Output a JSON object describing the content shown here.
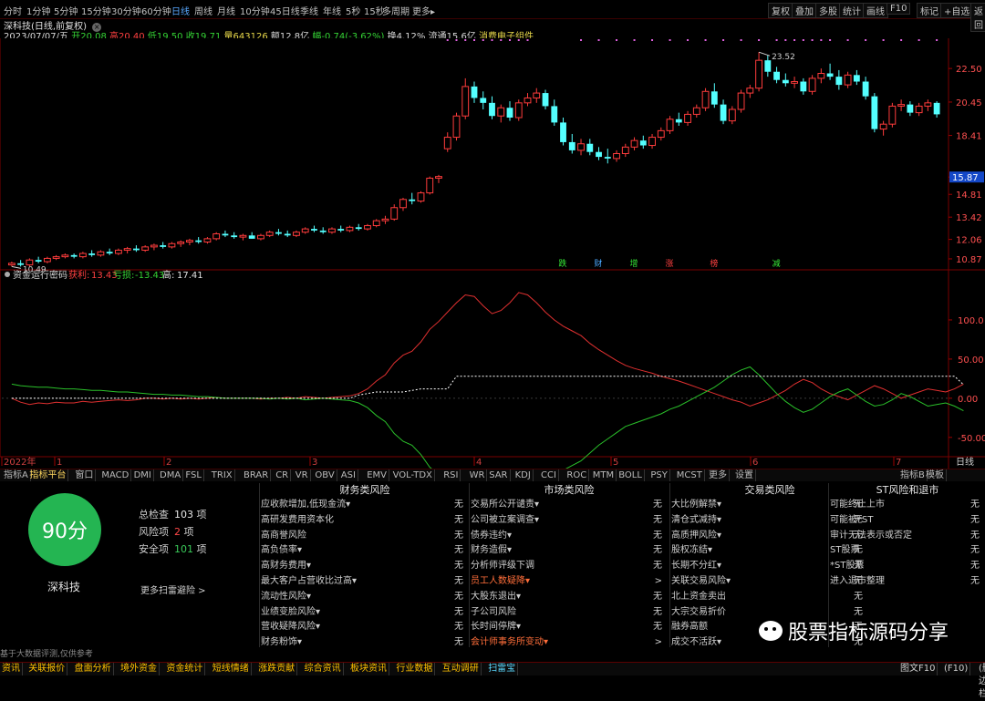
{
  "periods": [
    "分时",
    "1分钟",
    "5分钟",
    "15分钟",
    "30分钟",
    "60分钟",
    "日线",
    "周线",
    "月线",
    "10分钟",
    "45日线",
    "季线",
    "年线",
    "5秒",
    "15秒",
    "多周期",
    "更多▸"
  ],
  "active_period": "日线",
  "right_tools": [
    "复权",
    "叠加",
    "多股",
    "统计",
    "画线",
    "F10",
    "标记",
    "+自选",
    "返回"
  ],
  "title_line": "深科技(日线,前复权)",
  "info": {
    "date": "2023/07/07/五",
    "open_label": "开",
    "open": "20.08",
    "high_label": "高",
    "high": "20.40",
    "low_label": "低",
    "low": "19.50",
    "close_label": "收",
    "close": "19.71",
    "vol_label": "量",
    "vol": "643126",
    "amt_label": "额",
    "amt": "12.8亿",
    "chg_label": "幅",
    "chg": "-0.74(-3.62%)",
    "turn_label": "换",
    "turn": "4.12%",
    "float_label": "流通",
    "float": "15.6亿",
    "concept": "消费电子组件"
  },
  "price_axis": [
    "22.50",
    "20.45",
    "18.41",
    "15.87",
    "14.81",
    "13.42",
    "12.06",
    "10.87"
  ],
  "current_price_tag": "15.87",
  "price_high_mark": "23.52",
  "price_low_mark": "10.49",
  "markers": [
    "跌",
    "财",
    "增",
    "涨",
    "榜",
    "减"
  ],
  "indicator": {
    "name": "资金运行密码",
    "l1_label": "获利",
    "l1_value": "13.43",
    "l2_label": "亏损",
    "l2_value": "-13.43",
    "l3_label": "高",
    "l3_value": "17.41"
  },
  "ind_axis": [
    "100.0",
    "50.00",
    "0.00",
    "-50.00"
  ],
  "time_axis": [
    "2022年",
    "1",
    "2",
    "3",
    "4",
    "5",
    "6",
    "7"
  ],
  "time_axis_right": "日线",
  "tabs": [
    "指标A",
    "指标平台",
    "窗口",
    "MACD",
    "DMI",
    "DMA",
    "FSL",
    "TRIX",
    "BRAR",
    "CR",
    "VR",
    "OBV",
    "ASI",
    "EMV",
    "VOL-TDX",
    "RSI",
    "WR",
    "SAR",
    "KDJ",
    "CCI",
    "ROC",
    "MTM",
    "BOLL",
    "PSY",
    "MCST",
    "更多",
    "设置"
  ],
  "tabs_right": [
    "指标B",
    "模板"
  ],
  "score": {
    "value": "90分",
    "stock": "深科技",
    "total_label": "总检查",
    "total": "103",
    "total_unit": "项",
    "risk_label": "风险项",
    "risk": "2",
    "risk_unit": "项",
    "safe_label": "安全项",
    "safe": "101",
    "safe_unit": "项",
    "more": "更多扫雷避险 >",
    "disclaimer": "基于大数据评测,仅供参考"
  },
  "columns": [
    {
      "title": "财务类风险",
      "rows": [
        {
          "label": "应收款增加,低现金流▾",
          "v": "无"
        },
        {
          "label": "高研发费用资本化",
          "v": "无"
        },
        {
          "label": "高商誉风险",
          "v": "无"
        },
        {
          "label": "高负债率▾",
          "v": "无"
        },
        {
          "label": "高财务费用▾",
          "v": "无"
        },
        {
          "label": "最大客户占营收比过高▾",
          "v": "无"
        },
        {
          "label": "流动性风险▾",
          "v": "无"
        },
        {
          "label": "业绩变脸风险▾",
          "v": "无"
        },
        {
          "label": "营收疑降风险▾",
          "v": "无"
        },
        {
          "label": "财务粉饰▾",
          "v": "无"
        }
      ]
    },
    {
      "title": "市场类风险",
      "rows": [
        {
          "label": "交易所公开谴责▾",
          "v": "无"
        },
        {
          "label": "公司被立案调查▾",
          "v": "无"
        },
        {
          "label": "债券违约▾",
          "v": "无"
        },
        {
          "label": "财务造假▾",
          "v": "无"
        },
        {
          "label": "分析师评级下调",
          "v": "无"
        },
        {
          "label": "员工人数疑降▾",
          "v": ">",
          "warn": true
        },
        {
          "label": "大股东退出▾",
          "v": "无"
        },
        {
          "label": "子公司风险",
          "v": "无"
        },
        {
          "label": "长时间停牌▾",
          "v": "无"
        },
        {
          "label": "会计师事务所变动▾",
          "v": ">",
          "warn": true
        }
      ]
    },
    {
      "title": "交易类风险",
      "rows": [
        {
          "label": "大比例解禁▾",
          "v": "无"
        },
        {
          "label": "清仓式减持▾",
          "v": "无"
        },
        {
          "label": "高质押风险▾",
          "v": "无"
        },
        {
          "label": "股权冻结▾",
          "v": "无"
        },
        {
          "label": "长期不分红▾",
          "v": "无"
        },
        {
          "label": "关联交易风险▾",
          "v": "无"
        },
        {
          "label": "北上资金卖出",
          "v": "无"
        },
        {
          "label": "大宗交易折价",
          "v": "无"
        },
        {
          "label": "融券高额",
          "v": "无"
        },
        {
          "label": "成交不活跃▾",
          "v": "无"
        }
      ]
    },
    {
      "title": "ST风险和退市",
      "rows": [
        {
          "label": "可能终止上市",
          "v": "无"
        },
        {
          "label": "可能被*ST",
          "v": "无"
        },
        {
          "label": "审计无法表示或否定",
          "v": "无"
        },
        {
          "label": "ST股票",
          "v": "无"
        },
        {
          "label": "*ST股票",
          "v": "无"
        },
        {
          "label": "进入退市整理",
          "v": "无"
        }
      ]
    }
  ],
  "watermark": "股票指标源码分享",
  "footer": [
    "资讯",
    "关联报价",
    "盘面分析",
    "境外资金",
    "资金统计",
    "短线情绪",
    "涨跌贡献",
    "综合资讯",
    "板块资讯",
    "行业数据",
    "互动调研",
    "扫雷宝"
  ],
  "footer_right": [
    "图文F10",
    "(F10)",
    "(删边栏)"
  ],
  "chart_data": [
    {
      "type": "candlestick",
      "title": "深科技(日线,前复权)",
      "ylim": [
        10.2,
        23.9
      ],
      "ohlc": [
        [
          10.5,
          10.7,
          10.4,
          10.6
        ],
        [
          10.6,
          10.8,
          10.4,
          10.5
        ],
        [
          10.5,
          10.9,
          10.4,
          10.8
        ],
        [
          10.8,
          11.0,
          10.6,
          10.7
        ],
        [
          10.7,
          11.0,
          10.6,
          10.9
        ],
        [
          10.9,
          11.1,
          10.8,
          11.0
        ],
        [
          11.0,
          11.2,
          10.9,
          11.1
        ],
        [
          11.1,
          11.2,
          10.9,
          11.0
        ],
        [
          11.0,
          11.3,
          10.9,
          11.2
        ],
        [
          11.2,
          11.4,
          11.0,
          11.1
        ],
        [
          11.1,
          11.4,
          11.0,
          11.3
        ],
        [
          11.3,
          11.5,
          11.1,
          11.2
        ],
        [
          11.2,
          11.5,
          11.1,
          11.4
        ],
        [
          11.4,
          11.6,
          11.2,
          11.5
        ],
        [
          11.5,
          11.7,
          11.3,
          11.4
        ],
        [
          11.4,
          11.7,
          11.3,
          11.6
        ],
        [
          11.6,
          11.8,
          11.4,
          11.7
        ],
        [
          11.7,
          11.9,
          11.5,
          11.6
        ],
        [
          11.6,
          11.9,
          11.5,
          11.8
        ],
        [
          11.8,
          12.0,
          11.6,
          11.9
        ],
        [
          11.9,
          12.1,
          11.7,
          12.0
        ],
        [
          12.0,
          12.2,
          11.8,
          11.9
        ],
        [
          11.9,
          12.2,
          11.8,
          12.1
        ],
        [
          12.1,
          12.5,
          12.0,
          12.4
        ],
        [
          12.4,
          12.6,
          12.2,
          12.3
        ],
        [
          12.3,
          12.5,
          12.1,
          12.2
        ],
        [
          12.2,
          12.4,
          12.0,
          12.3
        ],
        [
          12.3,
          12.5,
          12.1,
          12.1
        ],
        [
          12.1,
          12.4,
          12.0,
          12.3
        ],
        [
          12.3,
          12.6,
          12.2,
          12.5
        ],
        [
          12.5,
          12.7,
          12.3,
          12.4
        ],
        [
          12.4,
          12.6,
          12.2,
          12.3
        ],
        [
          12.3,
          12.6,
          12.2,
          12.5
        ],
        [
          12.5,
          12.8,
          12.4,
          12.7
        ],
        [
          12.7,
          12.9,
          12.5,
          12.6
        ],
        [
          12.6,
          12.8,
          12.4,
          12.5
        ],
        [
          12.5,
          12.8,
          12.4,
          12.7
        ],
        [
          12.7,
          12.9,
          12.5,
          12.6
        ],
        [
          12.6,
          12.9,
          12.5,
          12.8
        ],
        [
          12.8,
          13.0,
          12.6,
          12.7
        ],
        [
          12.7,
          13.0,
          12.6,
          12.9
        ],
        [
          12.9,
          13.3,
          12.8,
          13.2
        ],
        [
          13.2,
          13.5,
          13.0,
          13.3
        ],
        [
          13.3,
          14.2,
          13.2,
          14.0
        ],
        [
          14.0,
          14.6,
          13.8,
          14.5
        ],
        [
          14.5,
          14.9,
          14.2,
          14.4
        ],
        [
          14.4,
          15.0,
          14.3,
          14.9
        ],
        [
          14.9,
          15.9,
          14.8,
          15.8
        ],
        [
          15.8,
          16.0,
          15.5,
          15.9
        ],
        [
          17.6,
          18.6,
          17.4,
          18.3
        ],
        [
          18.3,
          19.8,
          18.1,
          19.6
        ],
        [
          19.6,
          21.9,
          19.4,
          21.4
        ],
        [
          21.4,
          21.7,
          20.4,
          20.7
        ],
        [
          20.7,
          21.1,
          20.0,
          20.4
        ],
        [
          20.4,
          20.8,
          19.4,
          19.6
        ],
        [
          19.6,
          20.3,
          19.2,
          20.1
        ],
        [
          20.1,
          20.5,
          19.3,
          19.5
        ],
        [
          19.5,
          20.6,
          19.3,
          20.4
        ],
        [
          20.4,
          21.0,
          20.2,
          20.7
        ],
        [
          20.7,
          21.3,
          20.4,
          21.0
        ],
        [
          21.0,
          21.2,
          20.0,
          20.2
        ],
        [
          20.2,
          20.6,
          19.0,
          19.2
        ],
        [
          19.2,
          19.5,
          17.8,
          18.0
        ],
        [
          18.0,
          18.5,
          17.3,
          17.5
        ],
        [
          17.5,
          18.2,
          17.2,
          17.9
        ],
        [
          17.9,
          18.2,
          17.2,
          17.4
        ],
        [
          17.4,
          17.7,
          16.9,
          17.1
        ],
        [
          17.1,
          17.6,
          16.7,
          17.0
        ],
        [
          17.0,
          17.5,
          16.8,
          17.3
        ],
        [
          17.3,
          17.9,
          17.1,
          17.7
        ],
        [
          17.7,
          18.3,
          17.5,
          18.1
        ],
        [
          18.1,
          18.4,
          17.6,
          17.8
        ],
        [
          17.8,
          18.5,
          17.6,
          18.3
        ],
        [
          18.3,
          18.9,
          18.1,
          18.7
        ],
        [
          18.7,
          19.6,
          18.5,
          19.4
        ],
        [
          19.4,
          19.8,
          19.0,
          19.2
        ],
        [
          19.2,
          19.9,
          19.0,
          19.7
        ],
        [
          19.7,
          20.3,
          19.5,
          20.1
        ],
        [
          20.1,
          21.3,
          19.9,
          21.1
        ],
        [
          21.1,
          21.6,
          20.1,
          20.3
        ],
        [
          20.3,
          20.6,
          19.1,
          19.3
        ],
        [
          19.3,
          20.2,
          19.1,
          20.0
        ],
        [
          20.0,
          21.2,
          19.8,
          21.0
        ],
        [
          21.0,
          21.5,
          20.7,
          21.3
        ],
        [
          21.3,
          23.5,
          21.1,
          23.0
        ],
        [
          23.0,
          23.3,
          22.0,
          22.3
        ],
        [
          22.3,
          22.6,
          21.6,
          21.8
        ],
        [
          21.8,
          22.2,
          21.4,
          21.6
        ],
        [
          21.6,
          22.0,
          21.3,
          21.7
        ],
        [
          21.7,
          21.9,
          20.9,
          21.1
        ],
        [
          21.1,
          22.1,
          20.9,
          21.9
        ],
        [
          21.9,
          22.5,
          21.6,
          22.2
        ],
        [
          22.2,
          22.8,
          21.8,
          22.0
        ],
        [
          22.0,
          22.4,
          21.2,
          21.5
        ],
        [
          21.5,
          22.3,
          21.3,
          22.1
        ],
        [
          22.1,
          22.4,
          21.5,
          21.7
        ],
        [
          21.7,
          22.0,
          20.6,
          20.8
        ],
        [
          20.8,
          21.0,
          18.6,
          18.8
        ],
        [
          18.8,
          19.3,
          18.4,
          19.1
        ],
        [
          19.1,
          20.4,
          18.9,
          20.2
        ],
        [
          20.2,
          20.6,
          19.9,
          20.3
        ],
        [
          20.3,
          20.5,
          19.6,
          19.8
        ],
        [
          19.8,
          20.4,
          19.6,
          20.2
        ],
        [
          20.2,
          20.6,
          19.9,
          20.4
        ],
        [
          20.4,
          20.5,
          19.5,
          19.7
        ]
      ]
    },
    {
      "type": "line",
      "title": "资金运行密码",
      "ylim": [
        -70,
        150
      ],
      "series": [
        {
          "name": "获利",
          "color": "#e03030",
          "values": [
            0,
            -5,
            -8,
            -6,
            -7,
            -5,
            -6,
            -6,
            -4,
            -5,
            -4,
            -3,
            -2,
            -3,
            -2,
            0,
            0,
            -1,
            0,
            -1,
            0,
            -1,
            0,
            1,
            0,
            0,
            0,
            0,
            -1,
            0,
            0,
            1,
            0,
            2,
            1,
            0,
            1,
            2,
            3,
            6,
            12,
            22,
            30,
            45,
            55,
            60,
            72,
            88,
            98,
            110,
            122,
            132,
            130,
            118,
            108,
            112,
            122,
            135,
            132,
            122,
            110,
            100,
            92,
            86,
            80,
            70,
            62,
            55,
            48,
            42,
            38,
            35,
            32,
            28,
            25,
            22,
            18,
            14,
            10,
            6,
            2,
            -2,
            -5,
            -10,
            -6,
            -2,
            4,
            10,
            18,
            24,
            20,
            12,
            6,
            2,
            -2,
            4,
            10,
            16,
            12,
            6,
            0,
            4,
            8,
            12,
            10,
            8,
            12,
            18
          ]
        },
        {
          "name": "亏损",
          "color": "#2ac02a",
          "values": [
            18,
            16,
            15,
            14,
            14,
            13,
            12,
            12,
            11,
            10,
            10,
            9,
            8,
            8,
            7,
            6,
            5,
            5,
            4,
            4,
            3,
            2,
            2,
            1,
            0,
            0,
            0,
            0,
            0,
            -1,
            0,
            -1,
            0,
            -2,
            -1,
            0,
            -1,
            -2,
            -3,
            -6,
            -12,
            -22,
            -30,
            -45,
            -55,
            -60,
            -72,
            -88,
            -98,
            -110,
            -122,
            -132,
            -130,
            -118,
            -108,
            -112,
            -122,
            -135,
            -132,
            -122,
            -110,
            -100,
            -92,
            -86,
            -80,
            -70,
            -60,
            -52,
            -44,
            -36,
            -32,
            -28,
            -24,
            -20,
            -14,
            -10,
            -4,
            2,
            8,
            14,
            22,
            30,
            36,
            40,
            30,
            18,
            6,
            -4,
            -12,
            -18,
            -14,
            -6,
            2,
            8,
            12,
            4,
            -4,
            -10,
            -8,
            -2,
            6,
            2,
            -4,
            -10,
            -8,
            -6,
            -10,
            -16
          ]
        },
        {
          "name": "高",
          "color": "#ffffff",
          "values": [
            0,
            0,
            0,
            0,
            0,
            0,
            0,
            0,
            0,
            0,
            0,
            0,
            0,
            0,
            0,
            0,
            0,
            0,
            0,
            0,
            0,
            0,
            0,
            0,
            0,
            0,
            0,
            0,
            0,
            0,
            0,
            0,
            0,
            0,
            0,
            0,
            0,
            0,
            0,
            4,
            6,
            8,
            8,
            8,
            8,
            10,
            12,
            12,
            12,
            12,
            28,
            28,
            28,
            28,
            28,
            28,
            28,
            28,
            28,
            28,
            28,
            28,
            28,
            28,
            28,
            28,
            28,
            28,
            28,
            28,
            28,
            28,
            28,
            28,
            28,
            28,
            28,
            28,
            28,
            28,
            28,
            28,
            28,
            28,
            28,
            28,
            28,
            28,
            28,
            28,
            28,
            28,
            28,
            28,
            28,
            28,
            28,
            28,
            28,
            28,
            28,
            28,
            28,
            28,
            28,
            28,
            28,
            17.41
          ]
        }
      ]
    }
  ]
}
